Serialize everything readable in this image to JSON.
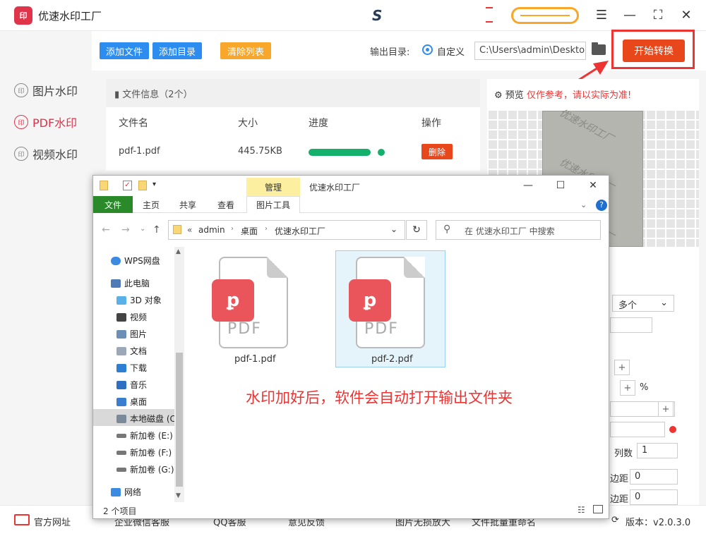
{
  "app": {
    "logo_text": "印",
    "title": "优速水印工厂",
    "brand_glyph": "S"
  },
  "sidebar": {
    "items": [
      {
        "label": "图片水印",
        "icon": "印"
      },
      {
        "label": "PDF水印",
        "icon": "印"
      },
      {
        "label": "视频水印",
        "icon": "印"
      }
    ]
  },
  "toolbar": {
    "add_file": "添加文件",
    "add_folder": "添加目录",
    "clear_list": "清除列表",
    "output_label": "输出目录:",
    "custom_label": "自定义",
    "path_value": "C:\\Users\\admin\\Deskto",
    "start_button": "开始转换"
  },
  "files": {
    "header": "文件信息（2个）",
    "columns": [
      "文件名",
      "大小",
      "进度",
      "操作"
    ],
    "rows": [
      {
        "name": "pdf-1.pdf",
        "size": "445.75KB",
        "progress": 1.0,
        "action": "删除"
      }
    ]
  },
  "preview": {
    "label": "预览",
    "warning": "仅作参考，请以实际为准!",
    "watermark_text": "优速水印工厂"
  },
  "settings": {
    "select_value": "多个",
    "percent": "%",
    "columns_label": "列数",
    "columns_value": "1",
    "margin_label": "边距",
    "margin_value": "0",
    "plus": "+"
  },
  "status": {
    "website": "官方网址",
    "wechat": "企业微信客服",
    "qq": "QQ客服",
    "feedback": "意见反馈",
    "enlarge": "图片无损放大",
    "rename": "文件批量重命名",
    "version": "版本：v2.0.3.0"
  },
  "explorer": {
    "context_tab": "管理",
    "window_title": "优速水印工厂",
    "tabs": [
      "文件",
      "主页",
      "共享",
      "查看",
      "图片工具"
    ],
    "breadcrumb": [
      "«",
      "admin",
      "桌面",
      "优速水印工厂"
    ],
    "search_placeholder": "在 优速水印工厂 中搜索",
    "nav": [
      "WPS网盘",
      "此电脑",
      "3D 对象",
      "视频",
      "图片",
      "文档",
      "下载",
      "音乐",
      "桌面",
      "本地磁盘 (C",
      "新加卷 (E:)",
      "新加卷 (F:)",
      "新加卷 (G:)",
      "网络"
    ],
    "files": [
      {
        "name": "pdf-1.pdf",
        "type_text": "PDF"
      },
      {
        "name": "pdf-2.pdf",
        "type_text": "PDF"
      }
    ],
    "status": "2 个项目",
    "help": "?"
  },
  "note": "水印加好后，软件会自动打开输出文件夹",
  "colors": {
    "accent": "#e0344a",
    "blue": "#2d8cf0",
    "orange": "#f8a72a",
    "start": "#e8471c",
    "green": "#15b06b"
  }
}
